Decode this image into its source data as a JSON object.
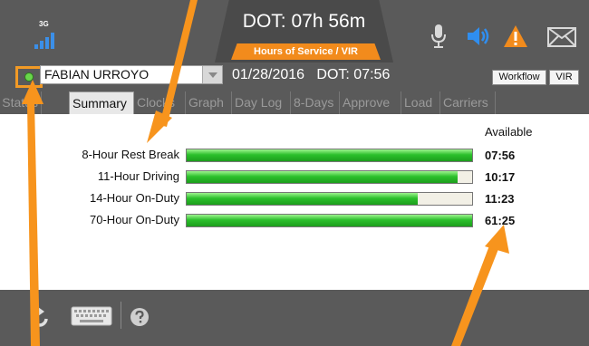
{
  "header": {
    "network_label": "3G",
    "dot_remaining": "DOT: 07h 56m",
    "section_tab": "Hours of Service / VIR"
  },
  "icons": {
    "signal": "signal-bars-icon",
    "mic": "microphone-icon",
    "speaker": "speaker-icon",
    "warning": "warning-icon",
    "mail": "mail-icon",
    "refresh": "refresh-icon",
    "keyboard": "keyboard-icon",
    "help": "help-icon"
  },
  "driver": {
    "name": "FABIAN URROYO",
    "date_dot": "01/28/2016   DOT: 07:56"
  },
  "buttons": {
    "workflow": "Workflow",
    "vir": "VIR"
  },
  "tabs": [
    {
      "label": "Status"
    },
    {
      "label": "Summary"
    },
    {
      "label": "Clocks"
    },
    {
      "label": "Graph"
    },
    {
      "label": "Day Log"
    },
    {
      "label": "8-Days"
    },
    {
      "label": "Approve"
    },
    {
      "label": "Load"
    },
    {
      "label": "Carriers"
    }
  ],
  "summary": {
    "available_header": "Available",
    "rows": [
      {
        "label": "8-Hour Rest Break",
        "value": "07:56",
        "fill": 1.0
      },
      {
        "label": "11-Hour Driving",
        "value": "10:17",
        "fill": 0.95
      },
      {
        "label": "14-Hour On-Duty",
        "value": "11:23",
        "fill": 0.81
      },
      {
        "label": "70-Hour On-Duty",
        "value": "61:25",
        "fill": 1.0
      }
    ]
  },
  "colors": {
    "accent_orange": "#f28b1c",
    "bar_green": "#2cc02c",
    "header_gray": "#5a5a5a",
    "signal_blue": "#3b8fe8"
  }
}
